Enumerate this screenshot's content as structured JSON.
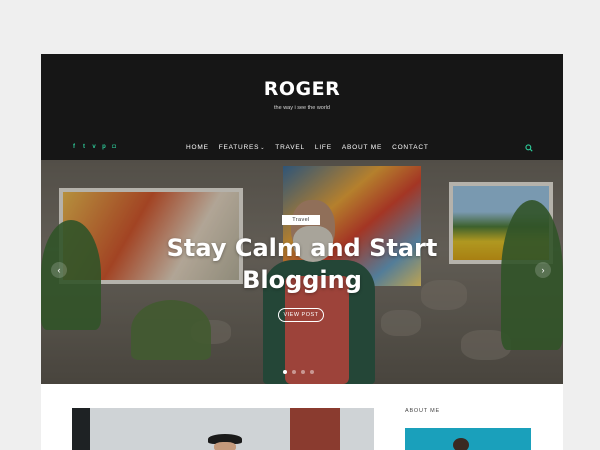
{
  "site": {
    "title": "ROGER",
    "tagline": "the way i see the world"
  },
  "social_icons": [
    "facebook-icon",
    "twitter-icon",
    "vimeo-icon",
    "pinterest-icon",
    "instagram-icon"
  ],
  "nav": {
    "items": [
      "HOME",
      "FEATURES",
      "TRAVEL",
      "LIFE",
      "ABOUT ME",
      "CONTACT"
    ]
  },
  "hero": {
    "category": "Travel",
    "title": "Stay Calm and Start Blogging",
    "button_label": "VIEW POST",
    "slide_count": 4,
    "active_slide": 1
  },
  "sidebar": {
    "about_label": "ABOUT ME"
  },
  "colors": {
    "header_bg": "#161616",
    "accent": "#2ecc9a",
    "page_bg": "#efefef"
  }
}
